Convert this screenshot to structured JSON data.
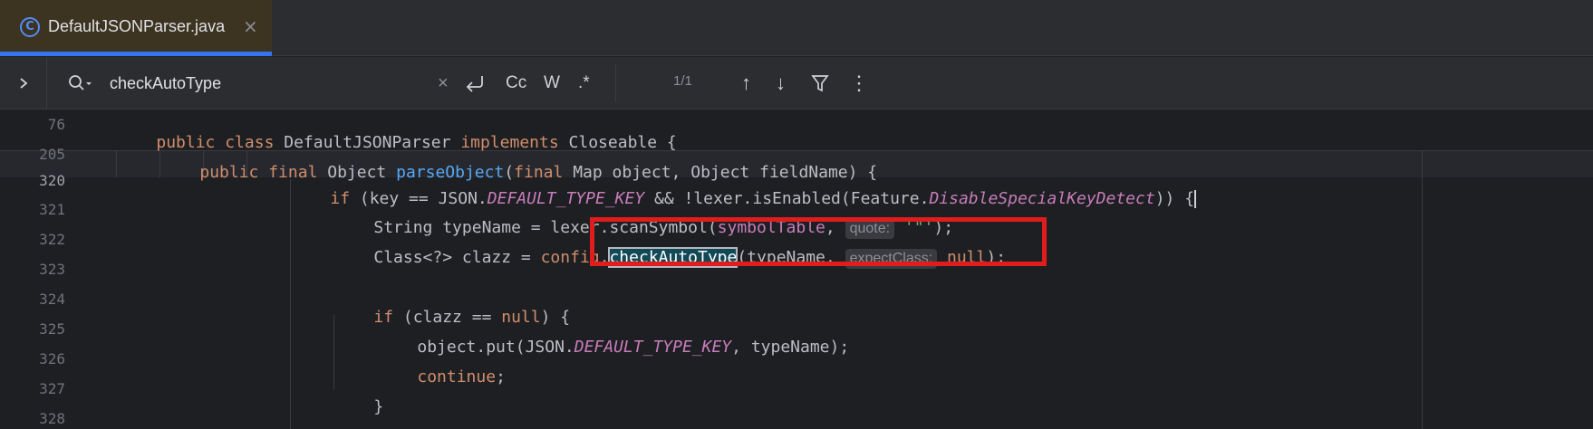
{
  "tab": {
    "icon_letter": "C",
    "label": "DefaultJSONParser.java",
    "close": "×"
  },
  "search": {
    "expand": "›",
    "value": "checkAutoType",
    "placeholder": "",
    "clear": "×",
    "regex": ".*",
    "case": "Cc",
    "words": "W",
    "count": "1/1",
    "prev": "↑",
    "next": "↓",
    "more": "⋮"
  },
  "editor": {
    "line_numbers": [
      "76",
      "205",
      "320",
      "321",
      "322",
      "323",
      "324",
      "325",
      "326",
      "327",
      "328"
    ],
    "line76": {
      "a": "public class ",
      "b": "DefaultJSONParser ",
      "c": "implements ",
      "d": "Closeable {"
    },
    "line205": {
      "a": "public final ",
      "b": "Object ",
      "c": "parseObject",
      "d": "(",
      "e": "final ",
      "f": "Map object, Object fieldName) {"
    },
    "line320": {
      "a": "if ",
      "b": "(key == JSON.",
      "c": "DEFAULT_TYPE_KEY",
      "d": " && !lexer.isEnabled(Feature.",
      "e": "DisableSpecialKeyDetect",
      "f": ")) {"
    },
    "line321": {
      "a": "String typeName = lexer.scanSymbol(",
      "b": "symbolTable",
      "c": ", ",
      "hint": "quote:",
      "d": " '\"'",
      "e": ");"
    },
    "line322": {
      "a": "Class<?> clazz = ",
      "b": "config",
      "c": ".",
      "match": "checkAutoType",
      "d": "(typeName, ",
      "hint": "expectClass:",
      "e": " null",
      "f": ");"
    },
    "line324": {
      "a": "if ",
      "b": "(clazz == ",
      "c": "null",
      "d": ") {"
    },
    "line325": {
      "a": "object.put(JSON.",
      "b": "DEFAULT_TYPE_KEY",
      "c": ", typeName);"
    },
    "line326": {
      "a": "continue",
      "b": ";"
    },
    "line327": {
      "a": "}"
    }
  },
  "colors": {
    "accent": "#3574f0",
    "keyword": "#cf8e6d",
    "function": "#56a8f5",
    "constant": "#c77dbb",
    "annotation_box": "#e01c1c"
  }
}
